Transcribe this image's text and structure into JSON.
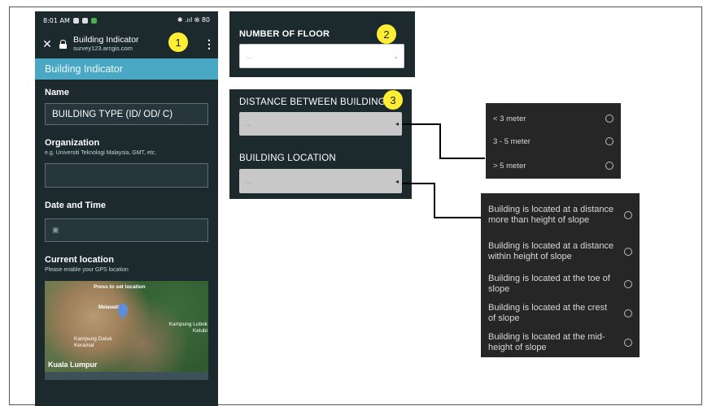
{
  "phone": {
    "status_time": "8:01 AM",
    "status_right": "✱ .ııl ⮿ 80",
    "browser_title": "Building Indicator",
    "browser_url": "survey123.arcgis.com",
    "app_header": "Building Indicator",
    "fields": {
      "name_label": "Name",
      "name_value": "BUILDING TYPE (ID/ OD/ C)",
      "org_label": "Organization",
      "org_hint": "e.g. Universiti Teknologi Malaysia, GMT, etc.",
      "date_label": "Date and Time",
      "location_label": "Current location",
      "location_hint": "Please enable your GPS location"
    },
    "map": {
      "press_label": "Press to set location",
      "place_a": "Melawati",
      "place_b": "Kampung Lubok Kelubi",
      "place_c": "Kampung Datuk Keramat",
      "city": "Kuala Lumpur"
    }
  },
  "badges": [
    "1",
    "2",
    "3"
  ],
  "floor_panel": {
    "label": "NUMBER OF FLOOR",
    "placeholder": "..."
  },
  "building_panel": {
    "distance_label": "DISTANCE BETWEEN BUILDING",
    "distance_placeholder": "...",
    "location_label": "BUILDING LOCATION",
    "location_placeholder": "..."
  },
  "distance_options": [
    "< 3 meter",
    "3 - 5 meter",
    "> 5 meter"
  ],
  "location_options": [
    "Building is located at a distance more than height of slope",
    "Building is located at a distance within height of slope",
    "Building is located at the toe of slope",
    "Building is located at the crest of slope",
    "Building is located at the mid-height of slope"
  ],
  "colors": {
    "panel_bg": "#1c2a2e",
    "accent": "#4aa8c4",
    "badge": "#ffee33",
    "option_bg": "#262626"
  }
}
